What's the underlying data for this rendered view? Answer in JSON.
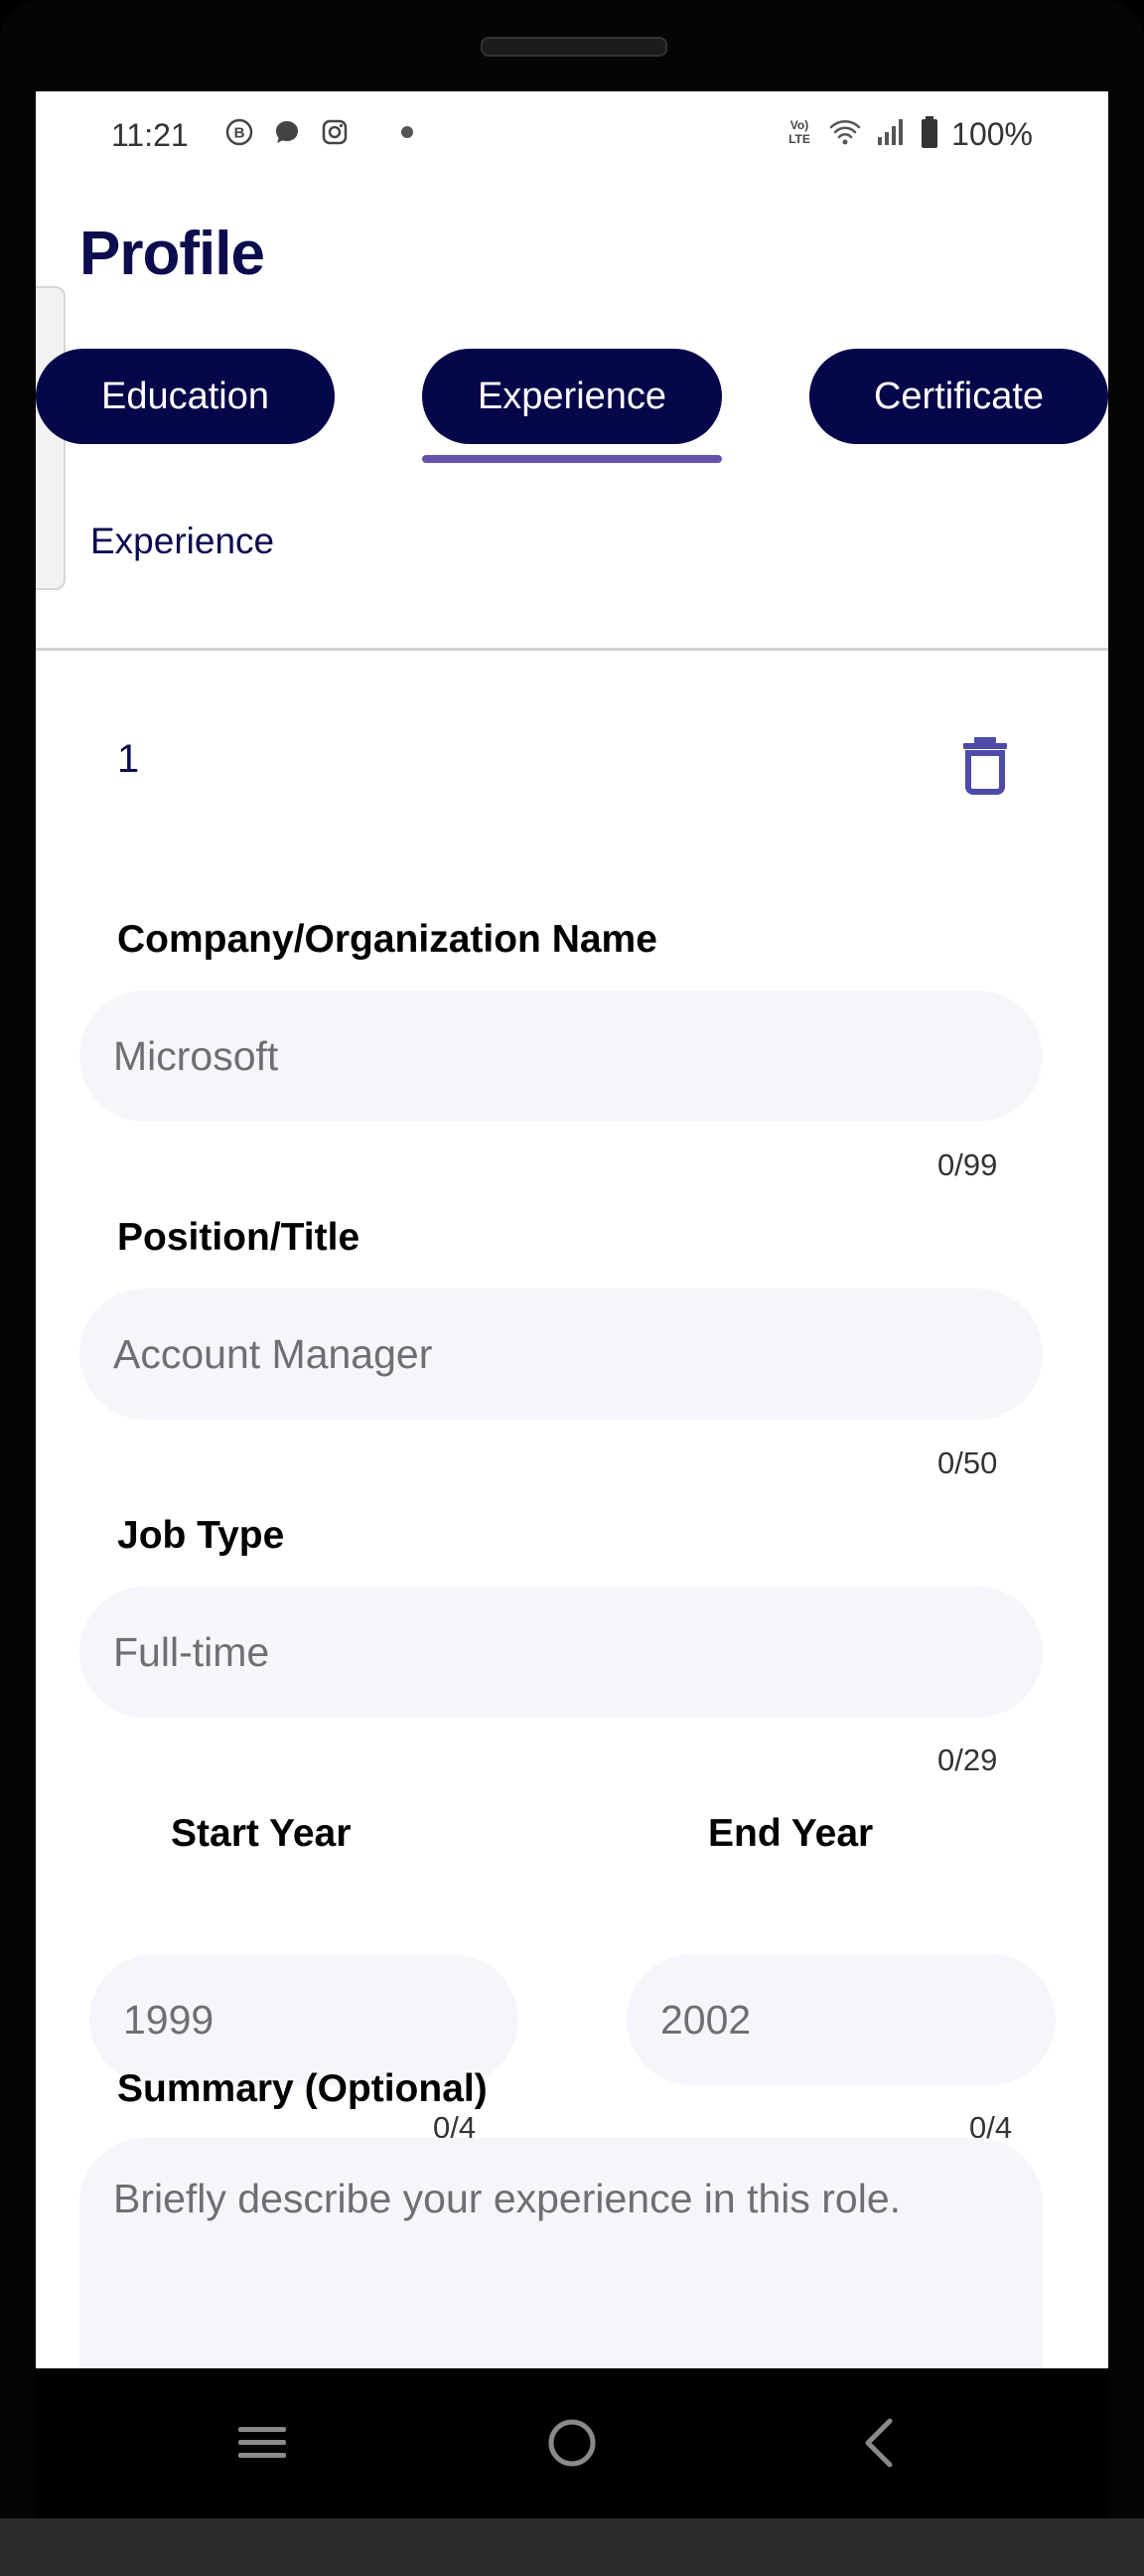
{
  "status_bar": {
    "time": "11:21",
    "left_icons": [
      "b-circle-icon",
      "chat-bubble-icon",
      "instagram-icon"
    ],
    "right_icons": [
      "volte-icon",
      "wifi-icon",
      "signal-icon",
      "battery-icon"
    ],
    "battery": "100%"
  },
  "page": {
    "title": "Profile"
  },
  "tabs": [
    {
      "label": "Education",
      "active": false
    },
    {
      "label": "Experience",
      "active": true
    },
    {
      "label": "Certificate",
      "active": false
    }
  ],
  "section": {
    "label": "Experience"
  },
  "entry": {
    "number": "1",
    "fields": {
      "company": {
        "label": "Company/Organization Name",
        "placeholder": "Microsoft",
        "counter": "0/99"
      },
      "position": {
        "label": "Position/Title",
        "placeholder": "Account Manager",
        "counter": "0/50"
      },
      "job_type": {
        "label": "Job Type",
        "placeholder": "Full-time",
        "counter": "0/29"
      },
      "start_year": {
        "label": "Start Year",
        "placeholder": "1999",
        "counter": "0/4"
      },
      "end_year": {
        "label": "End Year",
        "placeholder": "2002",
        "counter": "0/4"
      },
      "summary": {
        "label": "Summary (Optional)",
        "placeholder": "Briefly describe your experience in this role."
      }
    }
  },
  "colors": {
    "navy": "#06064a",
    "title": "#0c0c4e",
    "accent": "#6752b0",
    "delete_icon": "#4d4aa8",
    "field_bg": "#f5f6fb"
  },
  "nav_bar": {
    "icons": [
      "recent-apps-icon",
      "home-icon",
      "back-icon"
    ]
  }
}
